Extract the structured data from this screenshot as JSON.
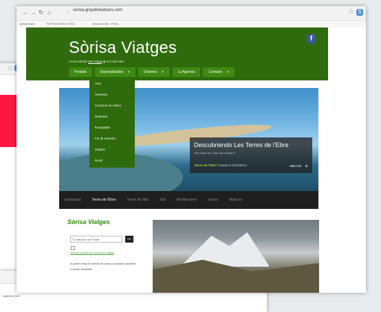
{
  "left_window": {
    "sync_btn": "S"
  },
  "bottom_window": {
    "sync_btn": "S",
    "bookmark": "Agencias Ihrd"
  },
  "browser": {
    "url": "sorisa.grupolineatours.com",
    "sync_btn": "S",
    "bookmarks": [
      "Aplicaciones",
      "RDP ECOGEN LT EDI...",
      "Venda en line - PrivE..."
    ]
  },
  "site": {
    "brand": "Sòrisa Viatges",
    "contact_phone": "| Soria 96200",
    "contact_link": "Veu mapa",
    "contact_extra": "674 863 063",
    "facebook_icon": "f",
    "menu": [
      {
        "label": "Portada",
        "caret": ""
      },
      {
        "label": "Especialidades",
        "caret": "▼"
      },
      {
        "label": "Destinos",
        "caret": "▼"
      },
      {
        "label": "La Agencia",
        "caret": ""
      },
      {
        "label": "Contacto",
        "caret": "▼"
      }
    ],
    "dropdown": [
      "Asia",
      "Aventura",
      "Cruceros en velero",
      "Deportes",
      "Escapadas",
      "Fin de semana",
      "Grupos",
      "Rural"
    ],
    "slider": {
      "title": "Descubriendo Les Terres de l'Ebre",
      "subtitle": "Tour Guiado de 1 Dias Todo Incluido B",
      "meta_place": "Terres de l'Ebre",
      "meta_date": "/ hasta el 13/12/2014",
      "more": "Más info",
      "plus": "+"
    },
    "tabs": [
      "Estrasquia",
      "Terres de l'Ebre",
      "Terres de l'Ebr",
      "Sali",
      "Mediterraneo",
      "Grecia",
      "Mallorca"
    ],
    "active_tab": 1,
    "sidebar": {
      "title": "Sòrisa Viatges",
      "email_placeholder": "Tu dirección de e-mail",
      "ok": "OK",
      "terms": "He leido y acepto las condiciones legales",
      "desc": "Si quieres estar al corriente de nuestra novedades suscríbete a nuestra Newsletter"
    }
  }
}
